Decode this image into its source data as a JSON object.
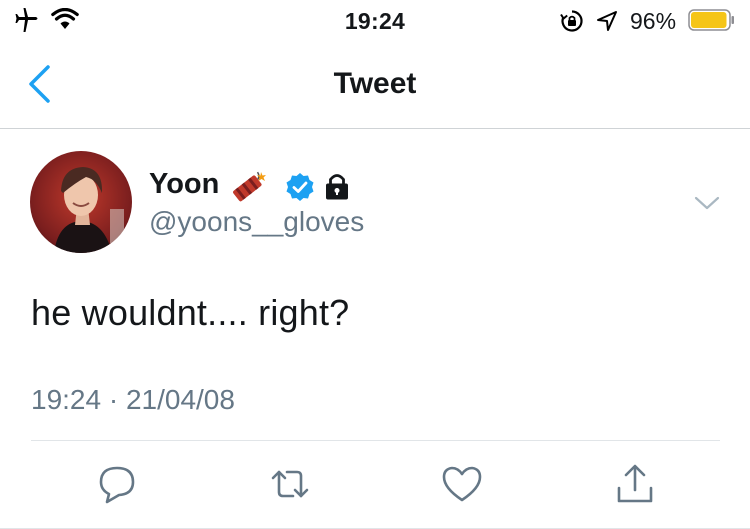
{
  "status_bar": {
    "time": "19:24",
    "battery_percent": "96%",
    "battery_level": 0.96,
    "battery_color": "#f5c518",
    "icons": [
      "airplane-icon",
      "wifi-icon",
      "orientation-lock-icon",
      "location-arrow-icon",
      "battery-icon"
    ]
  },
  "nav": {
    "title": "Tweet",
    "back_icon": "chevron-left-icon",
    "accent": "#1da1f2"
  },
  "tweet": {
    "author": {
      "display_name": "Yoon",
      "handle": "@yoons__gloves",
      "badges": [
        "firecracker-icon",
        "verified-badge-icon",
        "lock-icon"
      ]
    },
    "text": "he wouldnt.... right?",
    "timestamp": "19:24 · 21/04/08"
  },
  "actions": [
    "reply-icon",
    "retweet-icon",
    "like-icon",
    "share-icon"
  ]
}
